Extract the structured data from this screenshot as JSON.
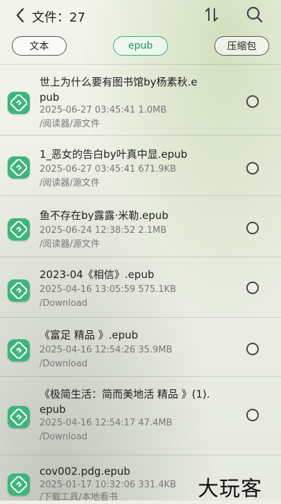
{
  "header": {
    "title": "文件：27",
    "icons": [
      "back-icon",
      "sort-icon",
      "search-icon"
    ]
  },
  "filters": [
    {
      "label": "文本",
      "active": false
    },
    {
      "label": "epub",
      "active": true
    },
    {
      "label": "压缩包",
      "active": false
    }
  ],
  "files": [
    {
      "name": "世上为什么要有图书馆by杨素秋.epub",
      "meta": "2025-06-27 03:45:41  1.0MB",
      "path": "/阅读器/源文件"
    },
    {
      "name": "1_恶女的告白by叶真中显.epub",
      "meta": "2025-06-27 03:45:41  671.9KB",
      "path": "/阅读器/源文件"
    },
    {
      "name": "鱼不存在by露露·米勒.epub",
      "meta": "2025-06-24 12:38:52  2.1MB",
      "path": "/阅读器/源文件"
    },
    {
      "name": "2023-04《相信》.epub",
      "meta": "2025-04-16 13:05:59  575.1KB",
      "path": "/Download"
    },
    {
      "name": "《富足 精品 》.epub",
      "meta": "2025-04-16 12:54:26  35.9MB",
      "path": "/Download"
    },
    {
      "name": "《极简生活：简而美地活 精品 》(1).epub",
      "meta": "2025-04-16 12:54:17  47.4MB",
      "path": "/Download"
    },
    {
      "name": "cov002.pdg.epub",
      "meta": "2025-01-17 10:32:06  331.4KB",
      "path": "/下载工具/本地看书"
    }
  ],
  "watermark": "大玩客",
  "colors": {
    "accent": "#3fb57e",
    "active_chip": "#1f8f62"
  }
}
